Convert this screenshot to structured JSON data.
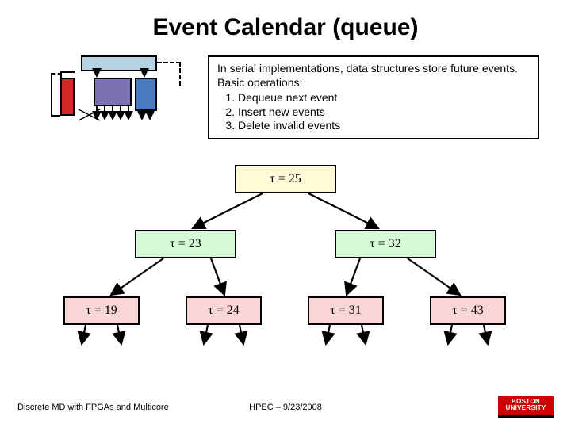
{
  "title": "Event Calendar (queue)",
  "description": {
    "intro": "In serial implementations, data structures store future events.  Basic operations:",
    "ops": [
      "Dequeue next event",
      "Insert new events",
      "Delete invalid events"
    ]
  },
  "tree": {
    "root": {
      "tau": "τ = 25"
    },
    "l": {
      "tau": "τ = 23"
    },
    "r": {
      "tau": "τ = 32"
    },
    "ll": {
      "tau": "τ = 19"
    },
    "lr": {
      "tau": "τ = 24"
    },
    "rl": {
      "tau": "τ = 31"
    },
    "rr": {
      "tau": "τ = 43"
    }
  },
  "footer": {
    "left": "Discrete MD with FPGAs and Multicore",
    "center": "HPEC  –  9/23/2008",
    "logo_top": "BOSTON",
    "logo_bot": "UNIVERSITY"
  }
}
